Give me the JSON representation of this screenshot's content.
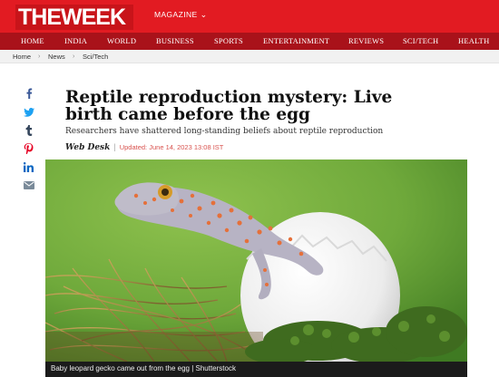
{
  "header": {
    "logo_text": "THEWEEK",
    "magazine_label": "MAGAZINE"
  },
  "nav": {
    "items": [
      "HOME",
      "INDIA",
      "WORLD",
      "BUSINESS",
      "SPORTS",
      "ENTERTAINMENT",
      "REVIEWS",
      "SCI/TECH",
      "HEALTH"
    ]
  },
  "breadcrumb": {
    "items": [
      "Home",
      "News",
      "Sci/Tech"
    ]
  },
  "share": {
    "icons": [
      "facebook-icon",
      "twitter-icon",
      "tumblr-icon",
      "pinterest-icon",
      "linkedin-icon",
      "email-icon"
    ]
  },
  "article": {
    "title": "Reptile reproduction mystery: Live birth came before the egg",
    "standfirst": "Researchers have shattered long-standing beliefs about reptile reproduction",
    "author": "Web Desk",
    "updated": "Updated: June 14, 2023 13:08 IST",
    "image_caption": "Baby leopard gecko came out from the egg | Shutterstock"
  },
  "colors": {
    "brand_red": "#e21b22",
    "nav_dark_red": "#a9121a",
    "updated_text": "#d9534f"
  }
}
